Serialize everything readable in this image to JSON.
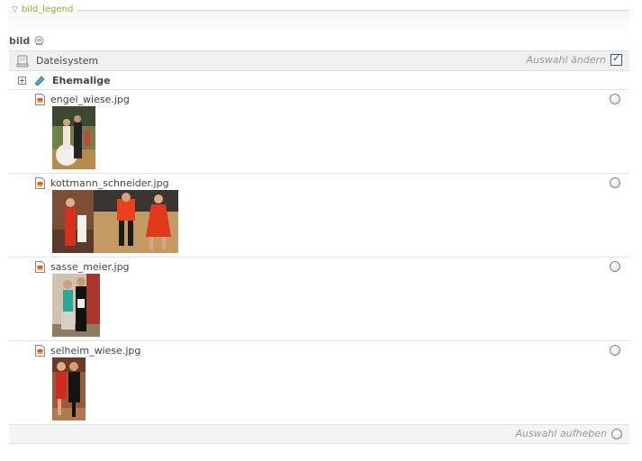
{
  "legend": {
    "title": "bild_legend"
  },
  "field": {
    "label": "bild"
  },
  "source": {
    "label": "Dateisystem",
    "change_label": "Auswahl ändern",
    "change_checked": true
  },
  "folder": {
    "label": "Ehemalige"
  },
  "files": [
    {
      "name": "engel_wiese.jpg"
    },
    {
      "name": "kottmann_schneider.jpg"
    },
    {
      "name": "sasse_meier.jpg"
    },
    {
      "name": "selheim_wiese.jpg"
    }
  ],
  "footer": {
    "clear_label": "Auswahl aufheben"
  },
  "colors": {
    "legend_green": "#8bb02b",
    "checkbox_blue": "#355b8c"
  }
}
